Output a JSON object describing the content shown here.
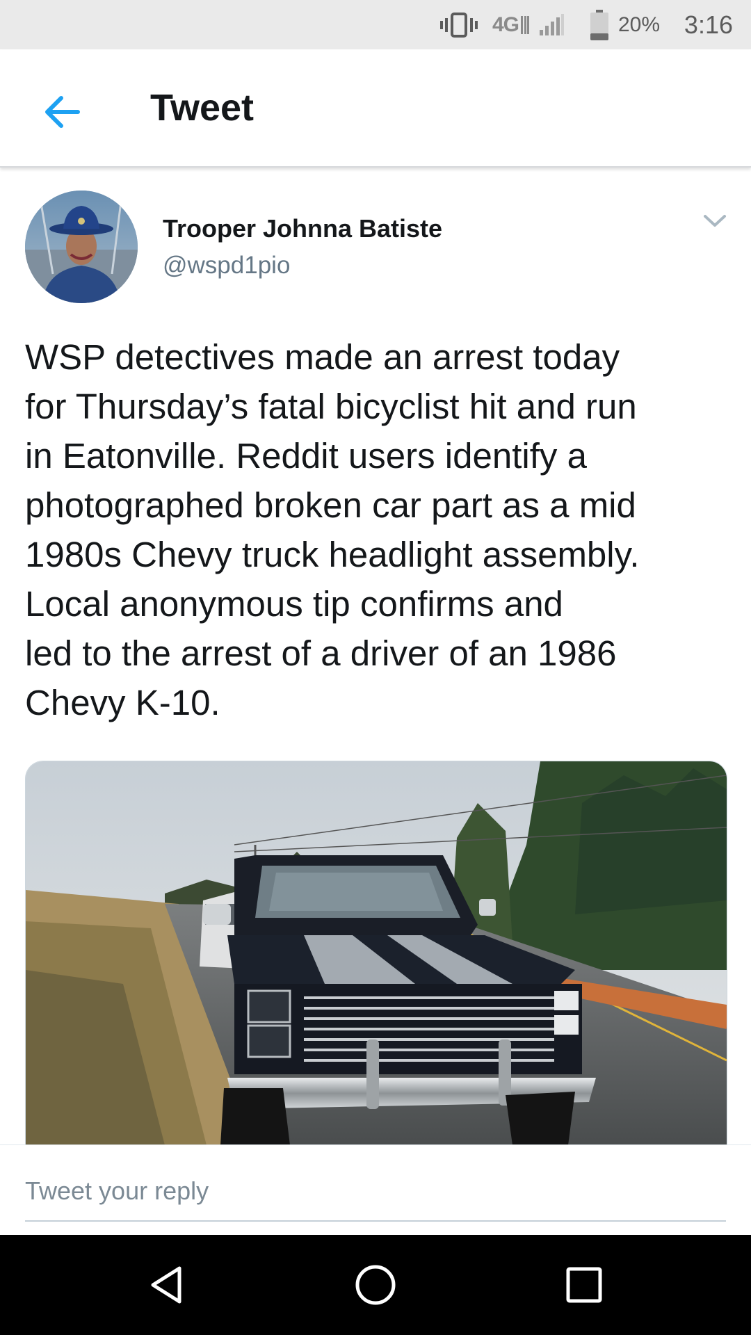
{
  "status_bar": {
    "network": "4G",
    "battery_percent": "20%",
    "time": "3:16",
    "icons": [
      "vibrate-icon",
      "network-lte-icon",
      "signal-icon",
      "battery-icon"
    ]
  },
  "header": {
    "back_icon": "arrow-left-icon",
    "title": "Tweet"
  },
  "tweet": {
    "author": {
      "name": "Trooper Johnna Batiste",
      "handle": "@wspd1pio"
    },
    "menu_icon": "chevron-down-icon",
    "text_lines": [
      "WSP detectives made an arrest today",
      "for Thursday’s fatal bicyclist hit and run",
      "in Eatonville. Reddit users identify a",
      "photographed broken car part as a mid",
      "1980s Chevy truck headlight assembly.",
      "Local anonymous tip confirms and",
      "led to the arrest of a driver of an 1986",
      "Chevy K-10."
    ]
  },
  "reply": {
    "placeholder": "Tweet your reply"
  },
  "nav": {
    "icons": [
      "nav-back-icon",
      "nav-home-icon",
      "nav-recents-icon"
    ]
  },
  "colors": {
    "accent": "#1da1f2",
    "text_primary": "#14171a",
    "text_secondary": "#657786",
    "status_bar_bg": "#eaeaea",
    "nav_bar_bg": "#000000"
  }
}
